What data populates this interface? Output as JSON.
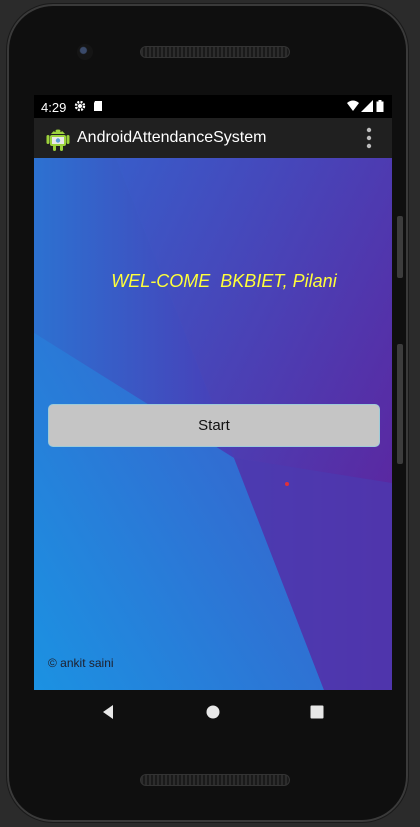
{
  "status_bar": {
    "time": "4:29",
    "left_icons": [
      "gear-icon",
      "sd-card-icon"
    ],
    "right_icons": [
      "wifi-icon",
      "signal-icon",
      "battery-icon"
    ]
  },
  "app_bar": {
    "title": "AndroidAttendanceSystem",
    "logo_icon": "android-logo-icon",
    "menu_icon": "overflow-menu-icon"
  },
  "main": {
    "welcome_text": "WEL-COME  BKBIET, Pilani",
    "start_button_label": "Start",
    "copyright_text": "© ankit saini"
  },
  "nav_bar": {
    "buttons": [
      "back-icon",
      "home-icon",
      "recents-icon"
    ]
  },
  "colors": {
    "welcome_text": "#ffff3a",
    "gradient_start": "#1e88d8",
    "gradient_end": "#5a22a0",
    "button_bg": "#c5c5c5"
  }
}
